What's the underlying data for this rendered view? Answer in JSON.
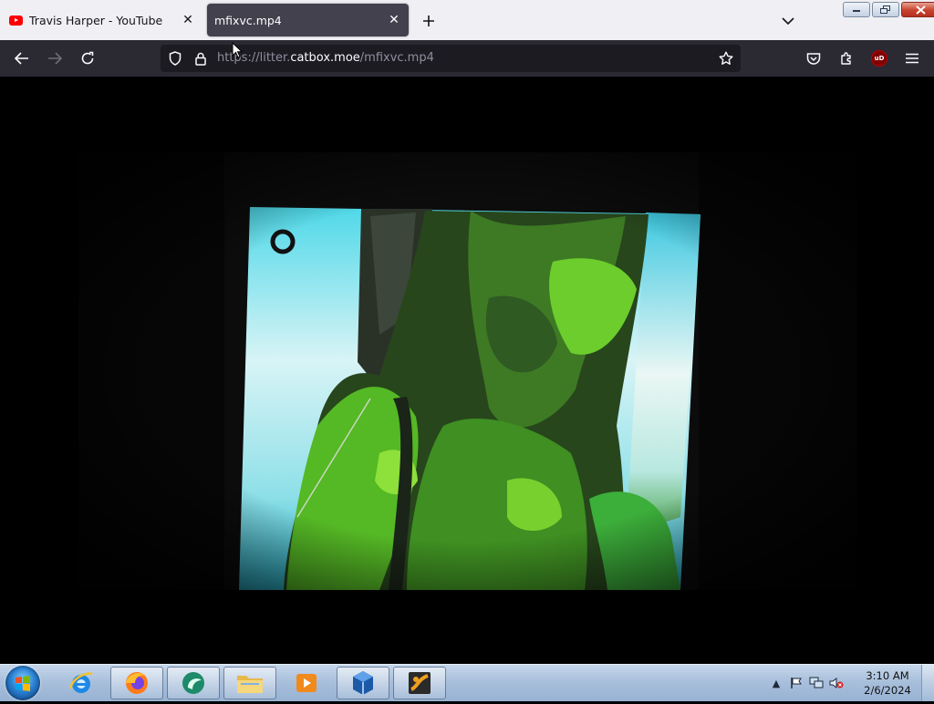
{
  "tabs": [
    {
      "title": "Travis Harper - YouTube",
      "active": false,
      "icon": "youtube-icon"
    },
    {
      "title": "mfixvc.mp4",
      "active": true,
      "icon": "none"
    }
  ],
  "tabstrip": {
    "new_tab_icon": "plus-icon",
    "list_all_tabs_icon": "chevron-down-icon"
  },
  "window_controls": [
    "minimize-icon",
    "restore-icon",
    "close-icon"
  ],
  "navbar": {
    "url_prefix": "https://litter.",
    "url_host": "catbox.moe",
    "url_path": "/mfixvc.mp4",
    "icons": [
      "back-icon",
      "forward-icon",
      "reload-icon",
      "tracking-shield-icon",
      "lock-icon",
      "bookmark-star-icon",
      "pocket-icon",
      "extensions-icon",
      "ublock-origin-icon",
      "menu-icon"
    ],
    "ublock_label": "uD"
  },
  "video": {
    "description_icon": "video-frame"
  },
  "taskbar": {
    "apps": [
      "internet-explorer-icon",
      "firefox-icon",
      "media-center-icon",
      "file-explorer-icon",
      "media-player-icon",
      "virtualbox-icon",
      "app-icon"
    ],
    "tray_icons": [
      "show-hidden-icons",
      "action-center-flag-icon",
      "network-icon",
      "volume-muted-icon"
    ],
    "time": "3:10 AM",
    "date": "2/6/2024"
  },
  "colors": {
    "tabstrip_bg": "#f0f0f4",
    "navbar_bg": "#2b2a33",
    "active_tab_bg": "#42414d",
    "urlbar_bg": "#1c1b22"
  }
}
